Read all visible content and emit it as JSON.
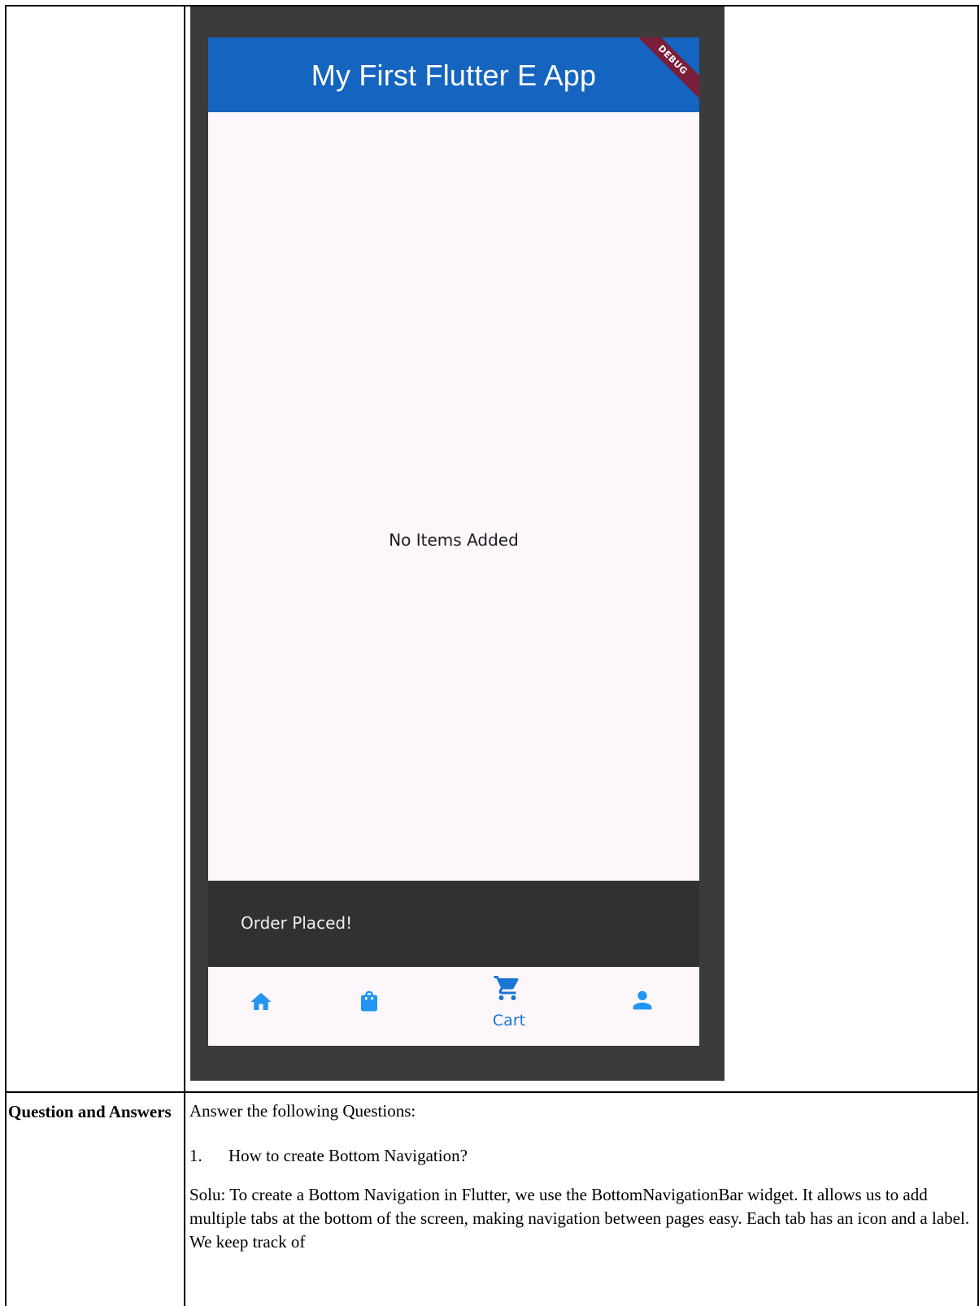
{
  "app": {
    "title": "My First Flutter E App",
    "debug_banner": "DEBUG",
    "empty_message": "No Items Added",
    "snackbar_text": "Order Placed!",
    "bottom_nav": {
      "items": [
        {
          "icon": "home-icon",
          "label": ""
        },
        {
          "icon": "shopping-bag-icon",
          "label": ""
        },
        {
          "icon": "shopping-cart-icon",
          "label": "Cart"
        },
        {
          "icon": "person-icon",
          "label": ""
        }
      ],
      "selected_index": 2,
      "active_color": "#1976d2",
      "inactive_color": "#2196f3"
    },
    "appbar_color": "#1565c0"
  },
  "document": {
    "row_label": "Question and Answers",
    "intro": "Answer the following Questions:",
    "question_number": "1.",
    "question": "How to create Bottom Navigation?",
    "solution": "Solu: To create a Bottom Navigation in Flutter, we use the BottomNavigationBar widget. It allows us to add multiple tabs at the bottom of the screen, making navigation between pages easy. Each tab has an icon and a label. We keep track of"
  }
}
